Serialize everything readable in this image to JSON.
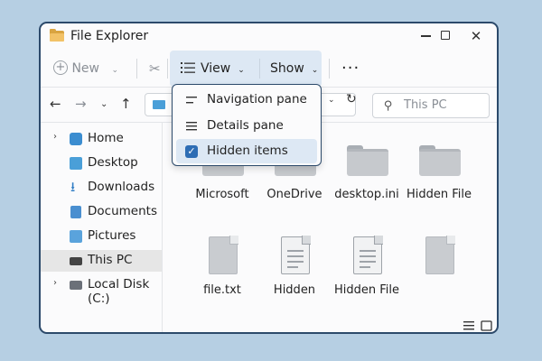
{
  "window": {
    "title": "File Explorer"
  },
  "toolbar": {
    "new_label": "New",
    "view_label": "View",
    "show_label": "Show",
    "more_label": "···"
  },
  "navbar": {
    "search_placeholder": "This PC"
  },
  "view_menu": {
    "items": [
      {
        "label": "Navigation pane",
        "icon": "navigation-pane-icon",
        "checked": false
      },
      {
        "label": "Details pane",
        "icon": "details-pane-icon",
        "checked": false
      },
      {
        "label": "Hidden items",
        "icon": "checkbox-icon",
        "checked": true
      }
    ]
  },
  "sidebar": {
    "items": [
      {
        "label": "Home",
        "icon": "home-icon",
        "expandable": true,
        "selected": false
      },
      {
        "label": "Desktop",
        "icon": "desktop-icon",
        "expandable": false,
        "selected": false
      },
      {
        "label": "Downloads",
        "icon": "download-icon",
        "expandable": false,
        "selected": false
      },
      {
        "label": "Documents",
        "icon": "documents-icon",
        "expandable": false,
        "selected": false
      },
      {
        "label": "Pictures",
        "icon": "pictures-icon",
        "expandable": false,
        "selected": false
      },
      {
        "label": "This PC",
        "icon": "computer-icon",
        "expandable": false,
        "selected": true
      },
      {
        "label": "Local Disk (C:)",
        "icon": "disk-icon",
        "expandable": true,
        "selected": false
      }
    ]
  },
  "files": [
    {
      "label": "Microsoft",
      "type": "folder"
    },
    {
      "label": "OneDrive",
      "type": "folder"
    },
    {
      "label": "desktop.ini",
      "type": "folder"
    },
    {
      "label": "Hidden File",
      "type": "folder"
    },
    {
      "label": "file.txt",
      "type": "blank-file"
    },
    {
      "label": "Hidden",
      "type": "document"
    },
    {
      "label": "Hidden File",
      "type": "document"
    },
    {
      "label": "",
      "type": "blank-file"
    }
  ],
  "colors": {
    "accent": "#2e6db4",
    "selection": "#dde8f4",
    "window_border": "#2c4a6b",
    "background": "#b6cfe3"
  }
}
